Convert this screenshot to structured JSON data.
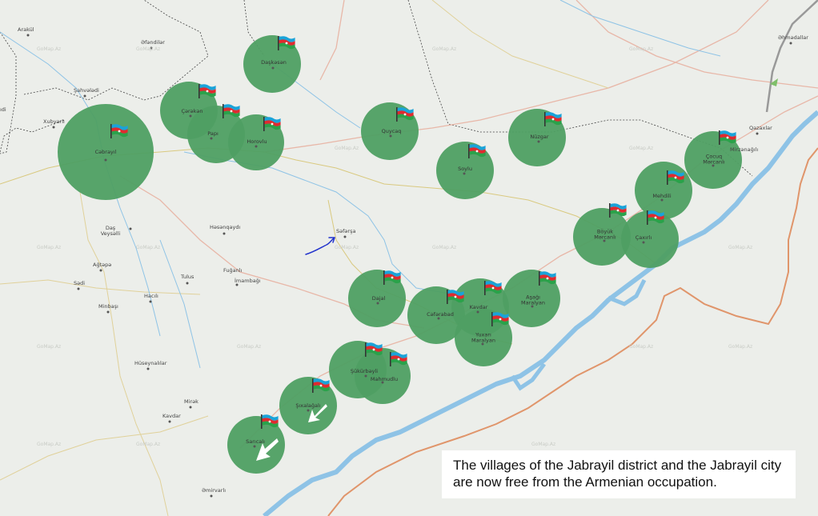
{
  "caption": "The villages of the Jabrayil district and the Jabrayil city are now free from the Armenian occupation.",
  "colors": {
    "liberated_circle": "#4f9f63",
    "river": "#8ec3e6",
    "border": "#e0956b",
    "road": "#e8b7a8",
    "background": "#eceeea"
  },
  "icons": {
    "flag": "azerbaijan-flag-icon",
    "arrow": "advance-arrow-icon",
    "hand_arrow": "hand-drawn-arrow-icon"
  },
  "liberated_villages": [
    {
      "name": "Cəbrayıl"
    },
    {
      "name": "Daşkəsən"
    },
    {
      "name": "Çərəkən"
    },
    {
      "name": "Papı"
    },
    {
      "name": "Horovlu"
    },
    {
      "name": "Quycaq"
    },
    {
      "name": "Nüzgar"
    },
    {
      "name": "Soylu"
    },
    {
      "name": "Çocuq Mərcanlı"
    },
    {
      "name": "Mehdili"
    },
    {
      "name": "Böyük Mərcanlı"
    },
    {
      "name": "Çaxırlı"
    },
    {
      "name": "Dajal"
    },
    {
      "name": "Cəfərabad"
    },
    {
      "name": "Kavdar"
    },
    {
      "name": "Aşağı Maralyan"
    },
    {
      "name": "Yuxarı Maralyan"
    },
    {
      "name": "Şükürbəyli"
    },
    {
      "name": "Mahmudlu"
    },
    {
      "name": "Şıxalağalı"
    },
    {
      "name": "Sarıcalı"
    }
  ],
  "places": [
    {
      "name": "Arakül"
    },
    {
      "name": "Əfəndilər"
    },
    {
      "name": "Şahvələdi"
    },
    {
      "name": "Xubyarlı"
    },
    {
      "name": "Daş Veysəlli"
    },
    {
      "name": "Ağtəpə"
    },
    {
      "name": "Sədi"
    },
    {
      "name": "Minbaşı"
    },
    {
      "name": "Həsənqaydı"
    },
    {
      "name": "Səfərşa"
    },
    {
      "name": "Tulus"
    },
    {
      "name": "Fuğanlı"
    },
    {
      "name": "İmambağı"
    },
    {
      "name": "Hacılı"
    },
    {
      "name": "Hüseynalılar"
    },
    {
      "name": "Mirək"
    },
    {
      "name": "Kavdar"
    },
    {
      "name": "Əmirvarlı"
    },
    {
      "name": "Qazaxlar"
    },
    {
      "name": "Mirzənağılı"
    },
    {
      "name": "Əhmədallar"
    },
    {
      "name": "ıdi"
    }
  ],
  "watermark": "GoMap.Az"
}
